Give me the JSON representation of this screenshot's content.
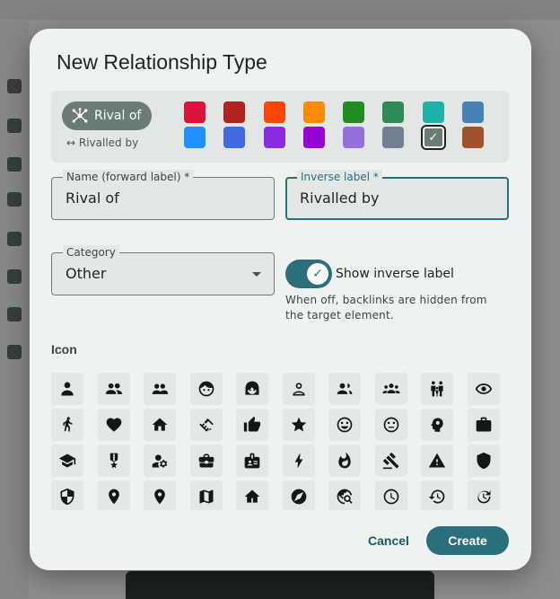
{
  "dialog": {
    "title": "New Relationship Type",
    "preview": {
      "label": "Rival of",
      "inverse": "↔ Rivalled by",
      "chip_color": "#6b7c77",
      "icon": "hub-icon"
    },
    "colors": [
      "#dc143c",
      "#b22222",
      "#ff4500",
      "#ff8c00",
      "#228b22",
      "#2e8b57",
      "#20b2aa",
      "#4682b4",
      "#1e90ff",
      "#4169e1",
      "#8a2be2",
      "#9400d3",
      "#9370db",
      "#708090",
      "#6b7c77",
      "#a0522d"
    ],
    "selected_color_index": 14,
    "forward_label": {
      "label": "Name (forward label)",
      "required": "*",
      "value": "Rival of"
    },
    "inverse_label": {
      "label": "Inverse label",
      "required": "*",
      "value": "Rivalled by"
    },
    "category": {
      "label": "Category",
      "value": "Other"
    },
    "show_inverse": {
      "label": "Show inverse label",
      "checked": true,
      "help": "When off, backlinks are hidden from the target element."
    },
    "icon_heading": "Icon",
    "icons": [
      "person-icon",
      "people-icon",
      "group-icon",
      "face-icon",
      "face-woman-icon",
      "person-outline-icon",
      "people-outline-icon",
      "groups-icon",
      "family-icon",
      "visibility-icon",
      "walking-icon",
      "heart-icon",
      "home-icon",
      "handshake-icon",
      "thumb-up-icon",
      "star-icon",
      "smile-icon",
      "neutral-face-icon",
      "psychology-icon",
      "work-icon",
      "school-icon",
      "military-medal-icon",
      "manage-accounts-icon",
      "business-center-icon",
      "badge-icon",
      "bolt-icon",
      "fire-icon",
      "gavel-icon",
      "warning-icon",
      "shield-icon",
      "security-icon",
      "place-icon",
      "location-icon",
      "map-icon",
      "house-icon",
      "explore-icon",
      "travel-explore-icon",
      "schedule-icon",
      "history-icon",
      "update-icon"
    ],
    "actions": {
      "cancel": "Cancel",
      "create": "Create"
    }
  }
}
